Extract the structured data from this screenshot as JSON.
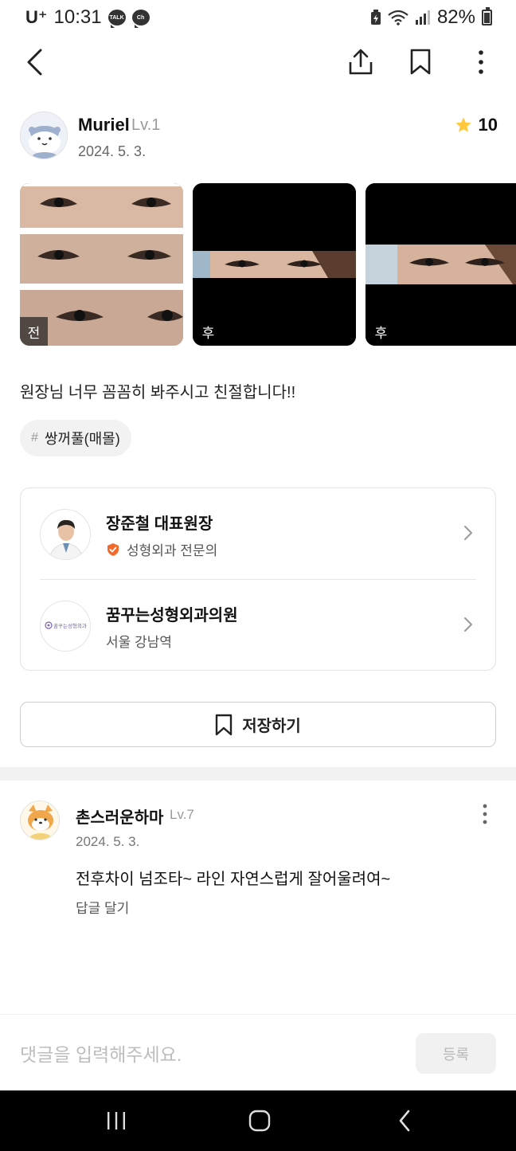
{
  "status_bar": {
    "carrier": "U⁺",
    "time": "10:31",
    "notif_1": "TALK",
    "notif_2": "Ch",
    "battery": "82%"
  },
  "top_bar": {
    "icons": [
      "back-arrow-icon",
      "share-icon",
      "bookmark-icon",
      "more-vertical-icon"
    ]
  },
  "review": {
    "author_name": "Muriel",
    "author_level": "Lv.1",
    "date": "2024. 5. 3.",
    "rating": "10",
    "photos": [
      {
        "tag": "전"
      },
      {
        "tag": "후"
      },
      {
        "tag": "후"
      }
    ],
    "text": "원장님 너무 꼼꼼히 봐주시고 친절합니다!!",
    "hashtag_symbol": "#",
    "hashtag": "쌍꺼풀(매몰)"
  },
  "doctor": {
    "name": "장준철 대표원장",
    "specialty": "성형외과 전문의"
  },
  "clinic": {
    "name": "꿈꾸는성형외과의원",
    "logo_text": "꿈꾸는성형외과",
    "location": "서울 강남역"
  },
  "save_button": {
    "label": "저장하기"
  },
  "comments": [
    {
      "name": "촌스러운하마",
      "level": "Lv.7",
      "date": "2024. 5. 3.",
      "text": "전후차이 넘조타~ 라인 자연스럽게 잘어울려여~",
      "reply_label": "답글 달기"
    }
  ],
  "comment_input": {
    "placeholder": "댓글을 입력해주세요.",
    "value": "",
    "submit_label": "등록"
  },
  "colors": {
    "star": "#FFC83D",
    "verified_badge": "#F26B2C",
    "border": "#E3E3E3",
    "muted": "#9A9A9A"
  }
}
